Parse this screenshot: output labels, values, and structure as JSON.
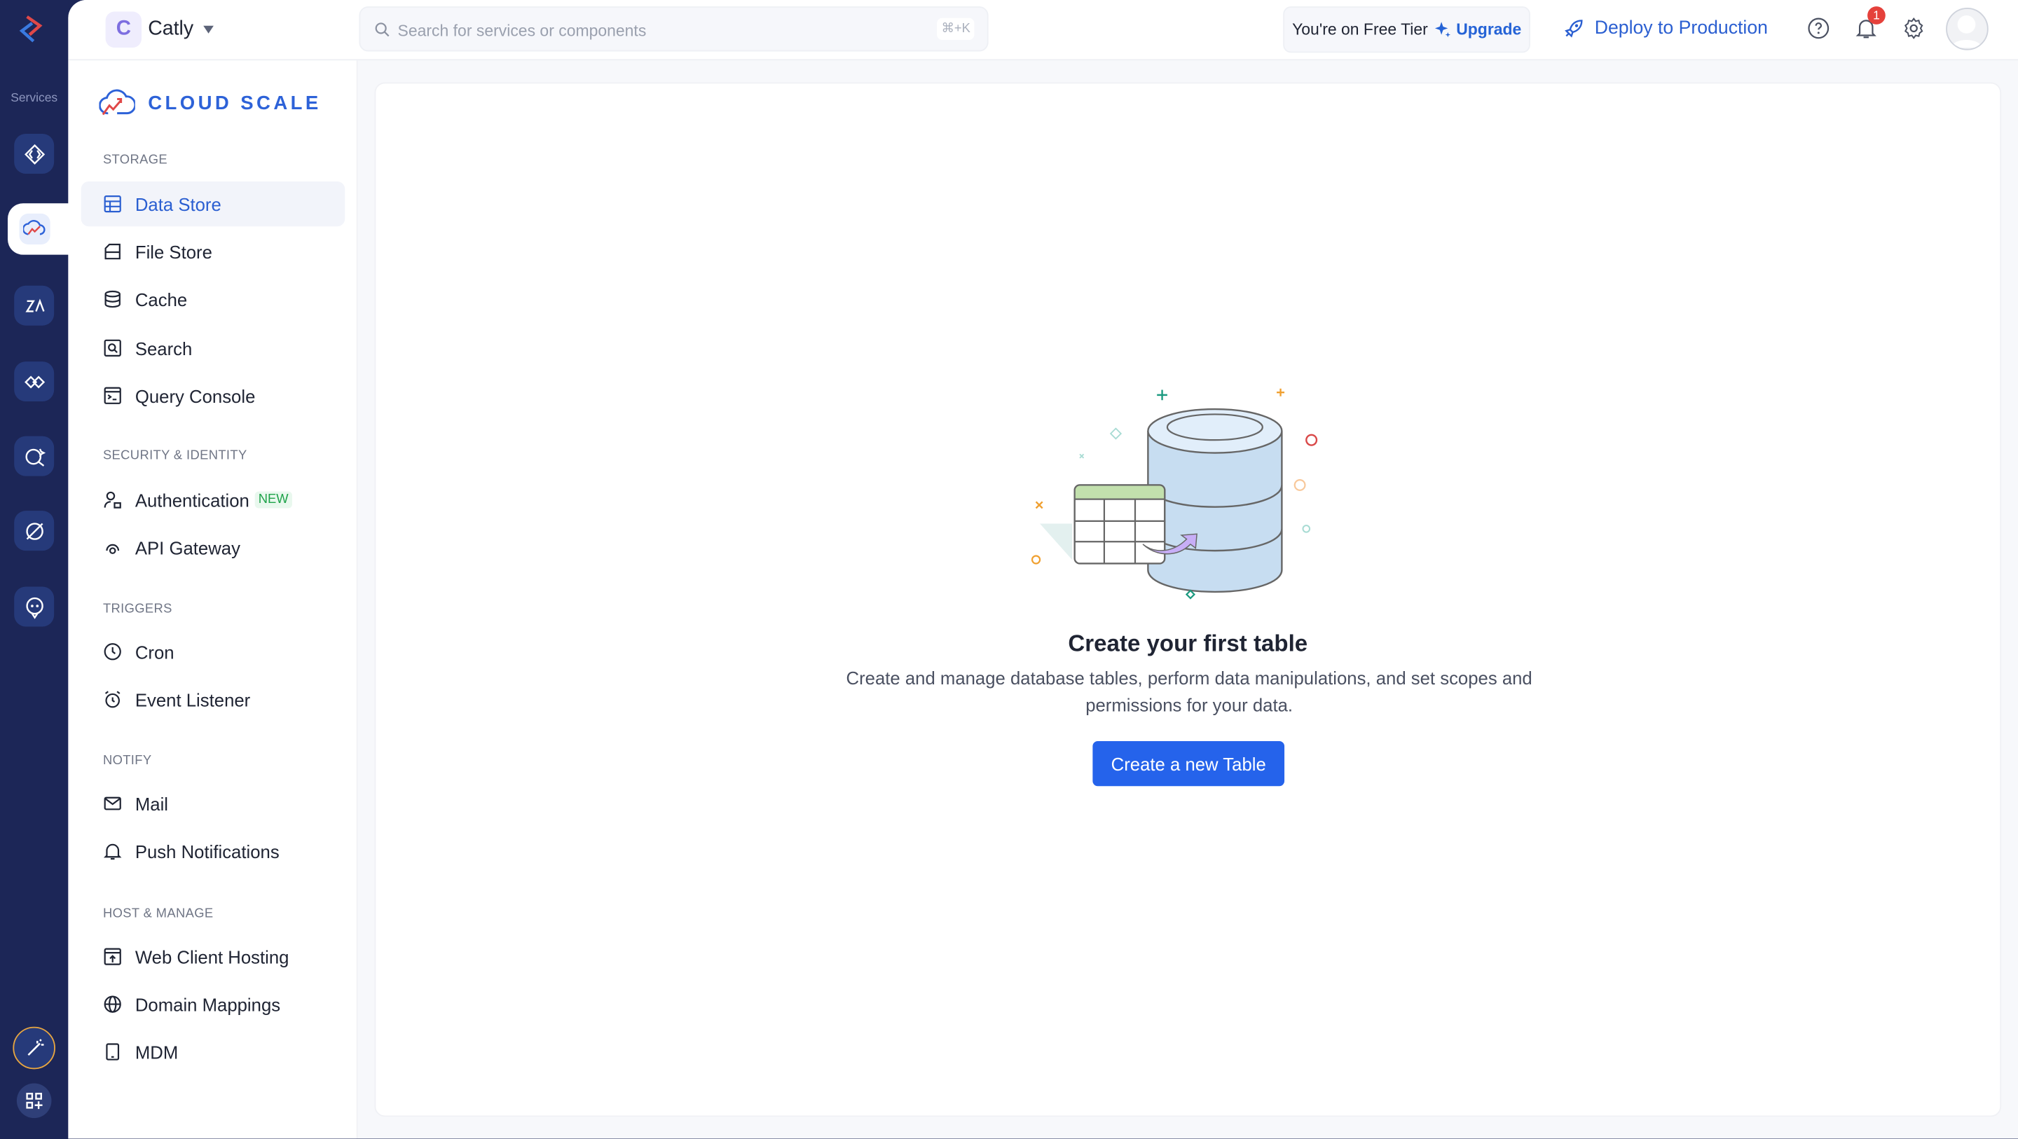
{
  "rail": {
    "services_label": "Services"
  },
  "header": {
    "project_initial": "C",
    "project_name": "Catly",
    "search_placeholder": "Search for services or components",
    "search_shortcut": "⌘+K",
    "tier_text": "You're on Free Tier",
    "upgrade_label": "Upgrade",
    "deploy_label": "Deploy to Production",
    "notification_count": "1"
  },
  "sidebar": {
    "brand": "CLOUD SCALE",
    "sections": [
      {
        "title": "STORAGE",
        "items": [
          "Data Store",
          "File Store",
          "Cache",
          "Search",
          "Query Console"
        ]
      },
      {
        "title": "SECURITY & IDENTITY",
        "items": [
          "Authentication",
          "API Gateway"
        ]
      },
      {
        "title": "TRIGGERS",
        "items": [
          "Cron",
          "Event Listener"
        ]
      },
      {
        "title": "NOTIFY",
        "items": [
          "Mail",
          "Push Notifications"
        ]
      },
      {
        "title": "HOST & MANAGE",
        "items": [
          "Web Client Hosting",
          "Domain Mappings",
          "MDM"
        ]
      }
    ],
    "new_badge": "NEW",
    "active_item": "Data Store"
  },
  "empty_state": {
    "title": "Create your first table",
    "description": "Create and manage database tables, perform data manipulations, and set scopes and permissions for your data.",
    "button_label": "Create a new Table"
  },
  "colors": {
    "accent": "#2563eb",
    "rail": "#1c2657",
    "brand": "#2d62d8"
  }
}
